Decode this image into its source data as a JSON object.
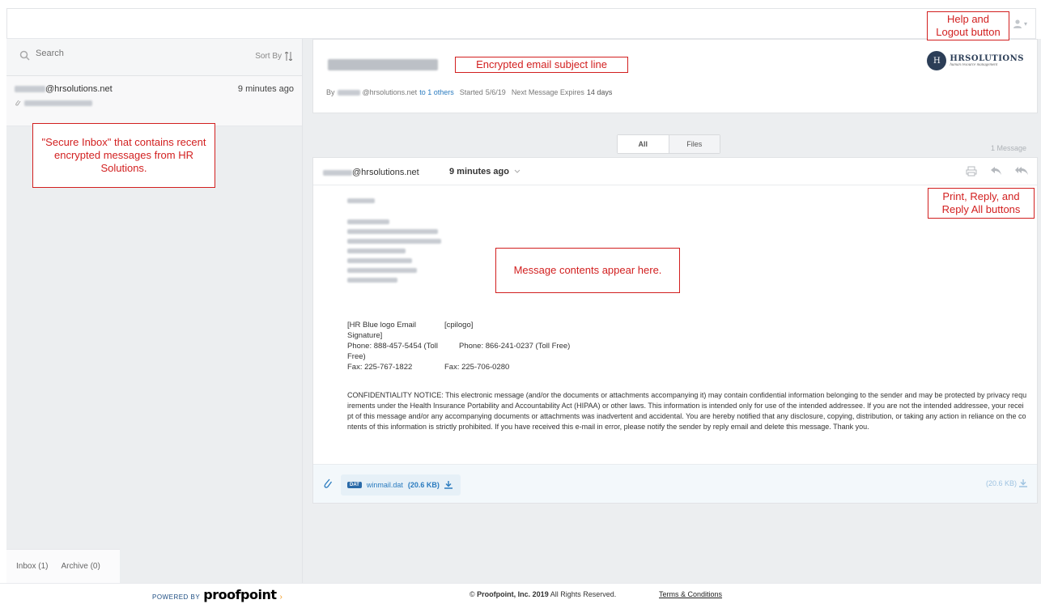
{
  "header": {
    "user_menu_icon": "user-icon",
    "user_menu_caret": "▾"
  },
  "inbox": {
    "search_placeholder": "Search",
    "sort_label": "Sort By",
    "items": [
      {
        "from_domain": "@hrsolutions.net",
        "time": "9 minutes ago"
      }
    ],
    "tabs": [
      {
        "label": "Inbox (1)"
      },
      {
        "label": "Archive (0)"
      }
    ]
  },
  "thread": {
    "meta_by": "By",
    "meta_from_domain": "@hrsolutions.net",
    "meta_to": "to",
    "meta_others": "1 others",
    "meta_started_label": "Started",
    "meta_started": "5/6/19",
    "meta_expires_label": "Next Message Expires",
    "meta_expires": "14 days",
    "logo_name": "HRSOLUTIONS",
    "logo_sub": "human resource management",
    "logo_mark": "H"
  },
  "filter": {
    "all_label": "All",
    "files_label": "Files",
    "count_label": "1 Message"
  },
  "message": {
    "from_domain": "@hrsolutions.net",
    "time": "9 minutes ago",
    "sig_left_1": "[HR Blue logo Email Signature]",
    "sig_left_2": "Phone: 888-457-5454 (Toll Free)",
    "sig_left_3": "Fax: 225-767-1822",
    "sig_right_1": "[cpilogo]",
    "sig_right_2": "Phone: 866-241-0237 (Toll Free)",
    "sig_right_3": "Fax: 225-706-0280",
    "confidentiality": "CONFIDENTIALITY NOTICE: This electronic message (and/or the documents or attachments accompanying it)  may contain confidential information belonging to the sender and may be protected by privacy requirements under the Health Insurance Portability and Accountability Act (HIPAA) or other laws.  This information is intended only for use of the intended addressee.  If you are not the intended addressee, your receipt of this message and/or any accompanying documents or attachments was inadvertent and accidental.  You are hereby notified that any disclosure, copying, distribution, or taking any action in reliance on the contents of this information is strictly prohibited.  If you have received this e-mail in error, please notify the sender by reply email and delete this message.  Thank you.",
    "attachment": {
      "badge": "DAT",
      "name": "winmail.dat",
      "size": "(20.6 KB)",
      "total_size": "(20.6 KB)"
    }
  },
  "footer": {
    "powered_by": "POWERED BY",
    "brand": "proofpoint",
    "copyright_symbol": "©",
    "copyright_company": "Proofpoint, Inc.",
    "copyright_year": "2019",
    "copyright_rest": "All Rights Reserved.",
    "terms": "Terms & Conditions"
  },
  "annotations": {
    "help_logout": "Help and Logout button",
    "subject": "Encrypted email subject line",
    "secure_inbox": "\"Secure Inbox\" that contains recent encrypted messages from HR Solutions.",
    "actions": "Print, Reply, and Reply All buttons",
    "contents": "Message contents appear here."
  },
  "colors": {
    "accent": "#2a7bbf",
    "annotation": "#d21f1f",
    "proofpoint_arrow": "#f39a1f"
  }
}
